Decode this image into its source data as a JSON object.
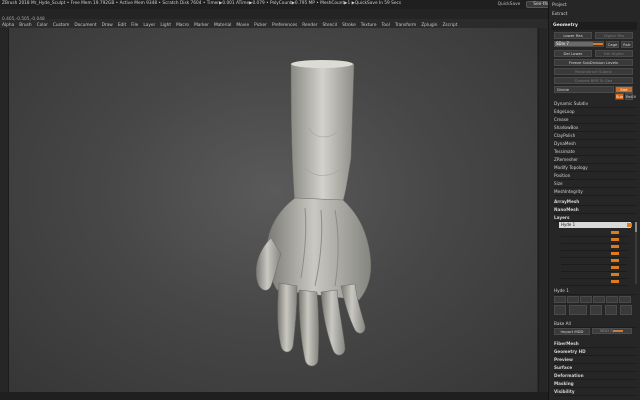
{
  "titlebar": {
    "info": "ZBrush 2018   Mr_Hyde_Sculpt   • Free Mem 19.792GB • Active Mem 9348 • Scratch Disk 7604 • Timer▶0.001 ATime▶0.079 • PolyCount▶0.795 MP • MeshCount▶1   ▶QuickSave In 59 Secs",
    "quicksave": "QuickSave",
    "seethrough": "See-through  0",
    "menus_label": "Menus",
    "script": "DefaultZScript"
  },
  "menubar": [
    "Alpha",
    "Brush",
    "Color",
    "Custom",
    "Document",
    "Draw",
    "Edit",
    "File",
    "Layer",
    "Light",
    "Macro",
    "Marker",
    "Material",
    "Movie",
    "Picker",
    "Preferences",
    "Render",
    "Stencil",
    "Stroke",
    "Texture",
    "Tool",
    "Transform",
    "Zplugin",
    "Zscript"
  ],
  "coords": "0.405,-0.505,-0.048",
  "tray": {
    "project": "Project",
    "extract": "Extract",
    "geometry": "Geometry",
    "lower_res": "Lower Res",
    "higher_res": "Higher Res",
    "sdiv": "SDiv 7",
    "cage": "Cage",
    "rstr": "Rstr",
    "del_lower": "Del Lower",
    "del_higher": "Del Higher",
    "freeze": "Freeze SubDivision Levels",
    "reconstruct": "Reconstruct Subdiv",
    "convert": "Convert BPR To Geo",
    "divide": "Divide",
    "smt": "Smt",
    "suv": "Suv",
    "reuv": "ReUV",
    "subs": [
      "Dynamic Subdiv",
      "EdgeLoop",
      "Crease",
      "ShadowBox",
      "ClayPolish",
      "DynaMesh",
      "Tessimate",
      "ZRemesher",
      "Modify Topology",
      "Position",
      "Size",
      "MeshIntegrity"
    ],
    "subs2": [
      "ArrayMesh",
      "NanoMesh"
    ],
    "layers": "Layers",
    "layer_name": "Hyde 1",
    "layer_footer": "Hyde 1",
    "bake_all": "Bake All",
    "import_mdd": "Import MDD",
    "mdd_speed": "MDD Speed",
    "more_sections": [
      "FiberMesh",
      "Geometry HD",
      "Preview",
      "Surface",
      "Deformation",
      "Masking",
      "Visibility"
    ]
  }
}
